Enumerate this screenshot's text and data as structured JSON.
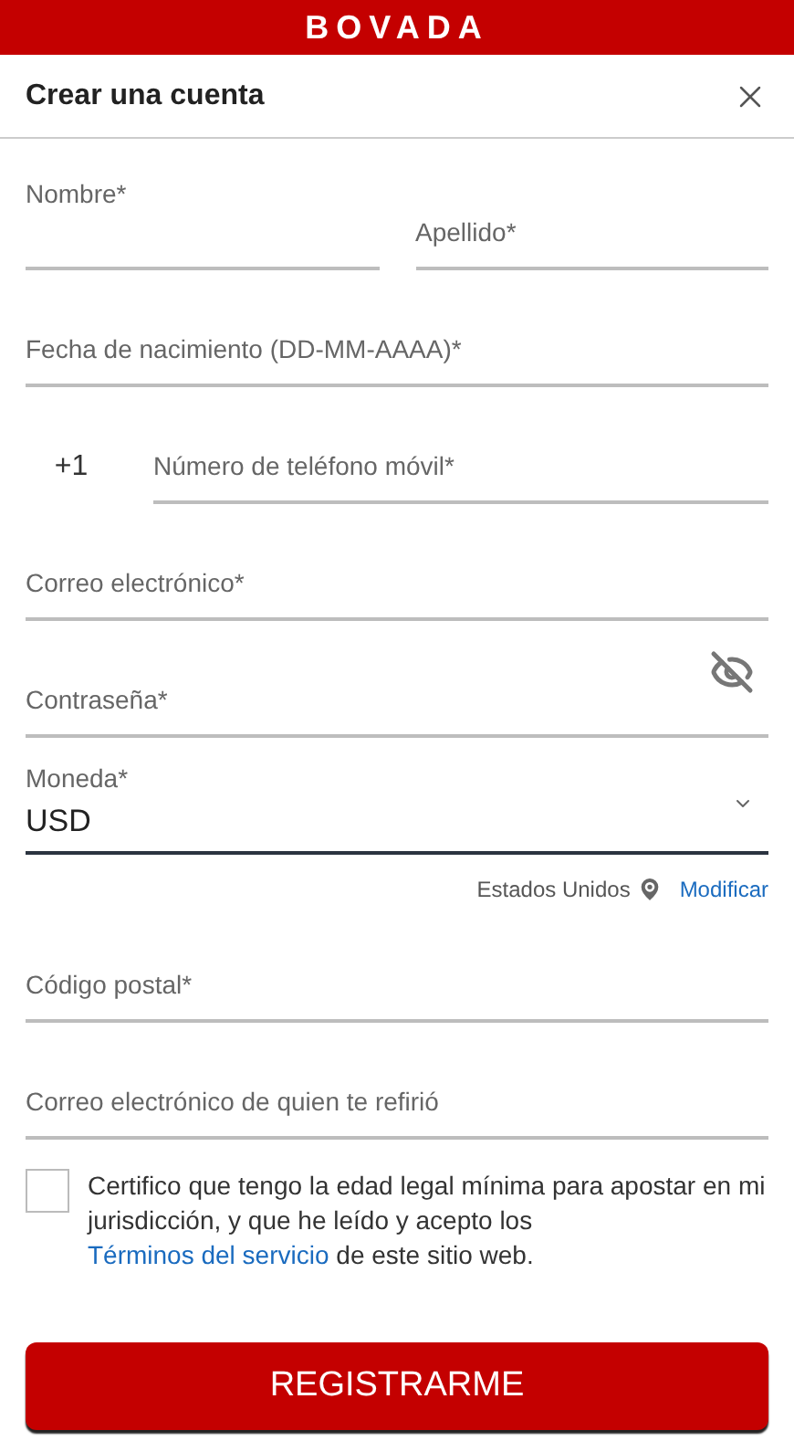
{
  "brand": "BOVADA",
  "title": "Crear una cuenta",
  "fields": [
    {
      "kind": "pair",
      "items": [
        {
          "label": "Nombre*",
          "floated": true
        },
        {
          "label": "Apellido*",
          "floated": false
        }
      ]
    },
    {
      "kind": "text",
      "label": "Fecha de nacimiento (DD-MM-AAAA)*"
    },
    {
      "kind": "phone",
      "prefix": "+1",
      "label": "Número de teléfono móvil*"
    },
    {
      "kind": "text",
      "label": "Correo electrónico*"
    },
    {
      "kind": "password",
      "label": "Contraseña*"
    },
    {
      "kind": "select",
      "label": "Moneda*",
      "value": "USD",
      "focused": true
    },
    {
      "kind": "location",
      "country": "Estados Unidos",
      "link": "Modificar"
    },
    {
      "kind": "text",
      "label": "Código postal*"
    },
    {
      "kind": "text",
      "label": "Correo electrónico de quien te refirió"
    }
  ],
  "terms": {
    "checked": false,
    "text_before": "Certifico que tengo la edad legal mínima para apostar en mi jurisdicción, y que he leído y acepto los",
    "link": "Términos del servicio",
    "text_after": "de este sitio web."
  },
  "submit": "REGISTRARME"
}
